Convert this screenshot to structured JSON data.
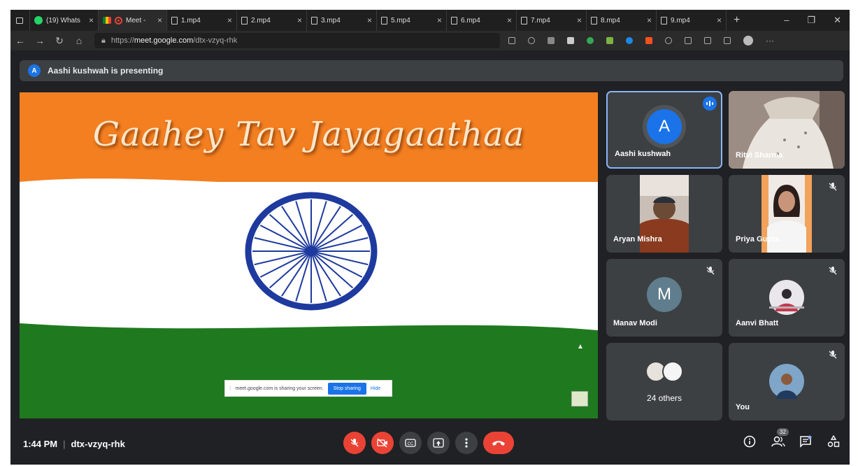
{
  "browser": {
    "tabs": [
      {
        "label": "(19) Whats",
        "icon": "whatsapp-icon"
      },
      {
        "label": "Meet -",
        "icon": "meet-icon",
        "active": true
      },
      {
        "label": "1.mp4",
        "icon": "file-icon"
      },
      {
        "label": "2.mp4",
        "icon": "file-icon"
      },
      {
        "label": "3.mp4",
        "icon": "file-icon"
      },
      {
        "label": "5.mp4",
        "icon": "file-icon"
      },
      {
        "label": "6.mp4",
        "icon": "file-icon"
      },
      {
        "label": "7.mp4",
        "icon": "file-icon"
      },
      {
        "label": "8.mp4",
        "icon": "file-icon"
      },
      {
        "label": "9.mp4",
        "icon": "file-icon"
      }
    ],
    "url_prefix": "https://",
    "url_host": "meet.google.com",
    "url_path": "/dtx-vzyq-rhk"
  },
  "presenting_banner": {
    "avatar_letter": "A",
    "text": "Aashi kushwah is presenting"
  },
  "slide": {
    "title": "Gaahey Tav Jayagaathaa",
    "share_notice": "meet.google.com is sharing your screen.",
    "stop_label": "Stop sharing",
    "hide_label": "Hide"
  },
  "participants": [
    {
      "name": "Aashi kushwah",
      "avatar_letter": "A",
      "avatar_color": "#1a73e8",
      "speaking": true
    },
    {
      "name": "Ritvi Sharma"
    },
    {
      "name": "Aryan Mishra"
    },
    {
      "name": "Priya Gupta",
      "muted": true
    },
    {
      "name": "Manav Modi",
      "avatar_letter": "M",
      "avatar_color": "#5f7d8c",
      "muted": true
    },
    {
      "name": "Aanvi Bhatt",
      "muted": true
    },
    {
      "others_label": "24 others"
    },
    {
      "name": "You",
      "muted": true
    }
  ],
  "bottom_bar": {
    "time": "1:44 PM",
    "separator": "|",
    "meeting_code": "dtx-vzyq-rhk",
    "people_count": "32"
  },
  "colors": {
    "saffron": "#f47f20",
    "green": "#1f7a1f",
    "chakra_blue": "#1e3a9e",
    "danger": "#ea4335",
    "accent": "#1a73e8"
  }
}
